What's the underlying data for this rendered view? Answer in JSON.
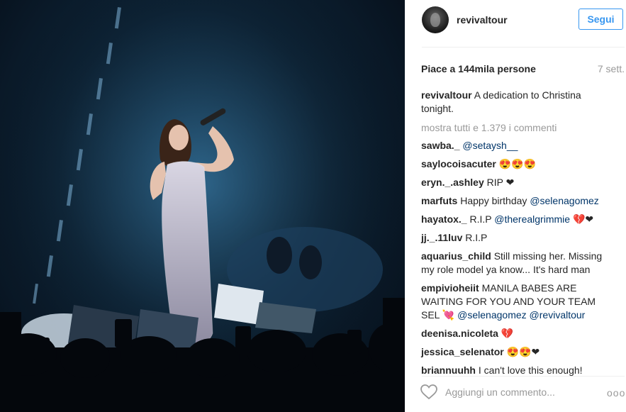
{
  "post": {
    "username": "revivaltour",
    "follow_label": "Segui",
    "likes_label": "Piace a 144mila persone",
    "time_ago": "7 sett.",
    "caption_user": "revivaltour",
    "caption_text": "A dedication to Christina tonight.",
    "show_all_label": "mostra tutti e 1.379 i commenti"
  },
  "comments": [
    {
      "user": "sawba._",
      "parts": [
        {
          "t": "",
          "m": "@setaysh__"
        }
      ]
    },
    {
      "user": "saylocoisacuter",
      "parts": [
        {
          "t": "😍😍😍"
        }
      ]
    },
    {
      "user": "eryn._.ashley",
      "parts": [
        {
          "t": "RIP ❤"
        }
      ]
    },
    {
      "user": "marfuts",
      "parts": [
        {
          "t": "Happy birthday "
        },
        {
          "m": "@selenagomez"
        }
      ]
    },
    {
      "user": "hayatox._",
      "parts": [
        {
          "t": "R.I.P "
        },
        {
          "m": "@therealgrimmie"
        },
        {
          "t": " 💔❤"
        }
      ]
    },
    {
      "user": "jj._.11luv",
      "parts": [
        {
          "t": "R.I.P"
        }
      ]
    },
    {
      "user": "aquarius_child",
      "parts": [
        {
          "t": "Still missing her. Missing my role model ya know... It's hard man"
        }
      ]
    },
    {
      "user": "empivioheiit",
      "parts": [
        {
          "t": "MANILA BABES ARE WAITING FOR YOU AND YOUR TEAM SEL 💘 "
        },
        {
          "m": "@selenagomez"
        },
        {
          "t": " "
        },
        {
          "m": "@revivaltour"
        }
      ]
    },
    {
      "user": "deenisa.nicoleta",
      "parts": [
        {
          "t": "💔"
        }
      ]
    },
    {
      "user": "jessica_selenator",
      "parts": [
        {
          "t": "😍😍❤"
        }
      ]
    },
    {
      "user": "briannuuhh",
      "parts": [
        {
          "t": "I can't love this enough!"
        }
      ]
    }
  ],
  "footer": {
    "add_comment_placeholder": "Aggiungi un commento...",
    "more_label": "ooo"
  }
}
